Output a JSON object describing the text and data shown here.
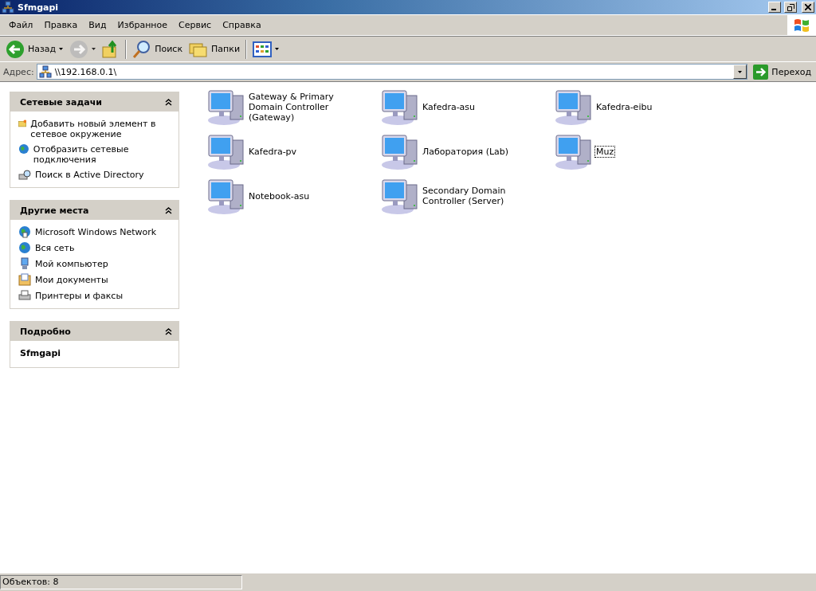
{
  "window": {
    "title": "Sfmgapi"
  },
  "menu": [
    "Файл",
    "Правка",
    "Вид",
    "Избранное",
    "Сервис",
    "Справка"
  ],
  "toolbar": [
    {
      "kind": "back",
      "label": "Назад",
      "disabled": false
    },
    {
      "kind": "forward",
      "disabled": true
    },
    {
      "kind": "up"
    },
    {
      "kind": "search",
      "label": "Поиск"
    },
    {
      "kind": "folders",
      "label": "Папки"
    },
    {
      "kind": "views"
    }
  ],
  "address": {
    "label": "Адрес:",
    "value": "\\\\192.168.0.1\\",
    "go_label": "Переход"
  },
  "sidebar": [
    {
      "title": "Сетевые задачи",
      "expanded": true,
      "items": [
        {
          "kind": "add",
          "label": "Добавить новый элемент в сетевое окружение"
        },
        {
          "kind": "connections",
          "label": "Отобразить сетевые подключения"
        },
        {
          "kind": "directory",
          "label": "Поиск в Active Directory"
        }
      ]
    },
    {
      "title": "Другие места",
      "expanded": true,
      "items": [
        {
          "kind": "network",
          "label": "Microsoft Windows Network"
        },
        {
          "kind": "globe",
          "label": "Вся сеть"
        },
        {
          "kind": "computer",
          "label": "Мой компьютер"
        },
        {
          "kind": "documents",
          "label": "Мои документы"
        },
        {
          "kind": "printers",
          "label": "Принтеры и факсы"
        }
      ]
    },
    {
      "title": "Подробно",
      "expanded": true,
      "details": "Sfmgapi"
    }
  ],
  "computers": [
    {
      "name": "Gateway & Primary Domain Controller (Gateway)",
      "focused": false
    },
    {
      "name": "Kafedra-asu",
      "focused": false
    },
    {
      "name": "Kafedra-eibu",
      "focused": false
    },
    {
      "name": "Kafedra-pv",
      "focused": false
    },
    {
      "name": "Лаборатория (Lab)",
      "focused": false
    },
    {
      "name": "Muz",
      "focused": true
    },
    {
      "name": "Notebook-asu",
      "focused": false
    },
    {
      "name": "Secondary Domain Controller (Server)",
      "focused": false
    }
  ],
  "status_bar": "Объектов: 8"
}
